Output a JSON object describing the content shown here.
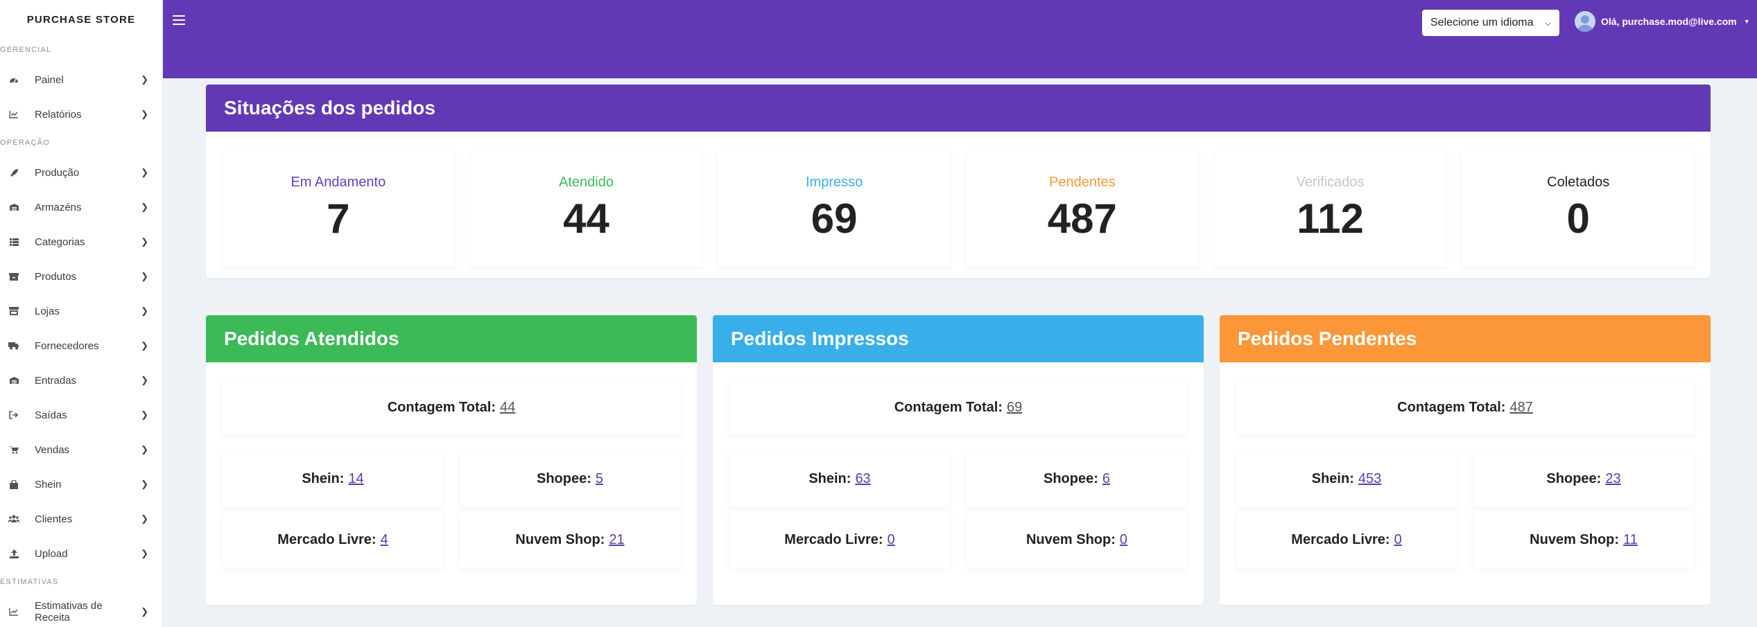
{
  "colors": {
    "purple": "#6239b5",
    "green": "#3dba58",
    "blue": "#38afe9",
    "orange": "#fb9738",
    "gray": "#c2c5cc"
  },
  "sidebar": {
    "brand": "PURCHASE STORE",
    "sections": [
      {
        "label": "GERENCIAL",
        "items": [
          {
            "label": "Painel",
            "icon": "dashboard-icon"
          },
          {
            "label": "Relatórios",
            "icon": "chart-icon"
          }
        ]
      },
      {
        "label": "OPERAÇÃO",
        "items": [
          {
            "label": "Produção",
            "icon": "rocket-icon"
          },
          {
            "label": "Armazéns",
            "icon": "warehouse-icon"
          },
          {
            "label": "Categorias",
            "icon": "list-icon"
          },
          {
            "label": "Produtos",
            "icon": "box-icon"
          },
          {
            "label": "Lojas",
            "icon": "store-icon"
          },
          {
            "label": "Fornecedores",
            "icon": "truck-icon"
          },
          {
            "label": "Entradas",
            "icon": "warehouse-icon"
          },
          {
            "label": "Saídas",
            "icon": "exit-icon"
          },
          {
            "label": "Vendas",
            "icon": "cart-icon"
          },
          {
            "label": "Shein",
            "icon": "bag-icon"
          },
          {
            "label": "Clientes",
            "icon": "users-icon"
          },
          {
            "label": "Upload",
            "icon": "upload-icon"
          }
        ]
      },
      {
        "label": "ESTIMATIVAS",
        "items": [
          {
            "label": "Estimativas de Receita",
            "icon": "chart-icon"
          }
        ]
      }
    ]
  },
  "header": {
    "language_select": "Selecione um idioma",
    "user_greeting": "Olá, purchase.mod@live.com"
  },
  "status": {
    "title": "Situações dos pedidos",
    "tiles": [
      {
        "label": "Em Andamento",
        "value": "7",
        "color": "#6a3bbf"
      },
      {
        "label": "Atendido",
        "value": "44",
        "color": "#3dba58"
      },
      {
        "label": "Impresso",
        "value": "69",
        "color": "#38afe9"
      },
      {
        "label": "Pendentes",
        "value": "487",
        "color": "#fb9738"
      },
      {
        "label": "Verificados",
        "value": "112",
        "color": "#c2c5cc"
      },
      {
        "label": "Coletados",
        "value": "0",
        "color": "#222222"
      }
    ]
  },
  "groups": [
    {
      "title": "Pedidos Atendidos",
      "color": "#3dba58",
      "total_label": "Contagem Total:",
      "total": "44",
      "shein_label": "Shein:",
      "shein": "14",
      "shopee_label": "Shopee:",
      "shopee": "5",
      "ml_label": "Mercado Livre:",
      "ml": "4",
      "nuvem_label": "Nuvem Shop:",
      "nuvem": "21"
    },
    {
      "title": "Pedidos Impressos",
      "color": "#38afe9",
      "total_label": "Contagem Total:",
      "total": "69",
      "shein_label": "Shein:",
      "shein": "63",
      "shopee_label": "Shopee:",
      "shopee": "6",
      "ml_label": "Mercado Livre:",
      "ml": "0",
      "nuvem_label": "Nuvem Shop:",
      "nuvem": "0"
    },
    {
      "title": "Pedidos Pendentes",
      "color": "#fb9738",
      "total_label": "Contagem Total:",
      "total": "487",
      "shein_label": "Shein:",
      "shein": "453",
      "shopee_label": "Shopee:",
      "shopee": "23",
      "ml_label": "Mercado Livre:",
      "ml": "0",
      "nuvem_label": "Nuvem Shop:",
      "nuvem": "11"
    }
  ]
}
